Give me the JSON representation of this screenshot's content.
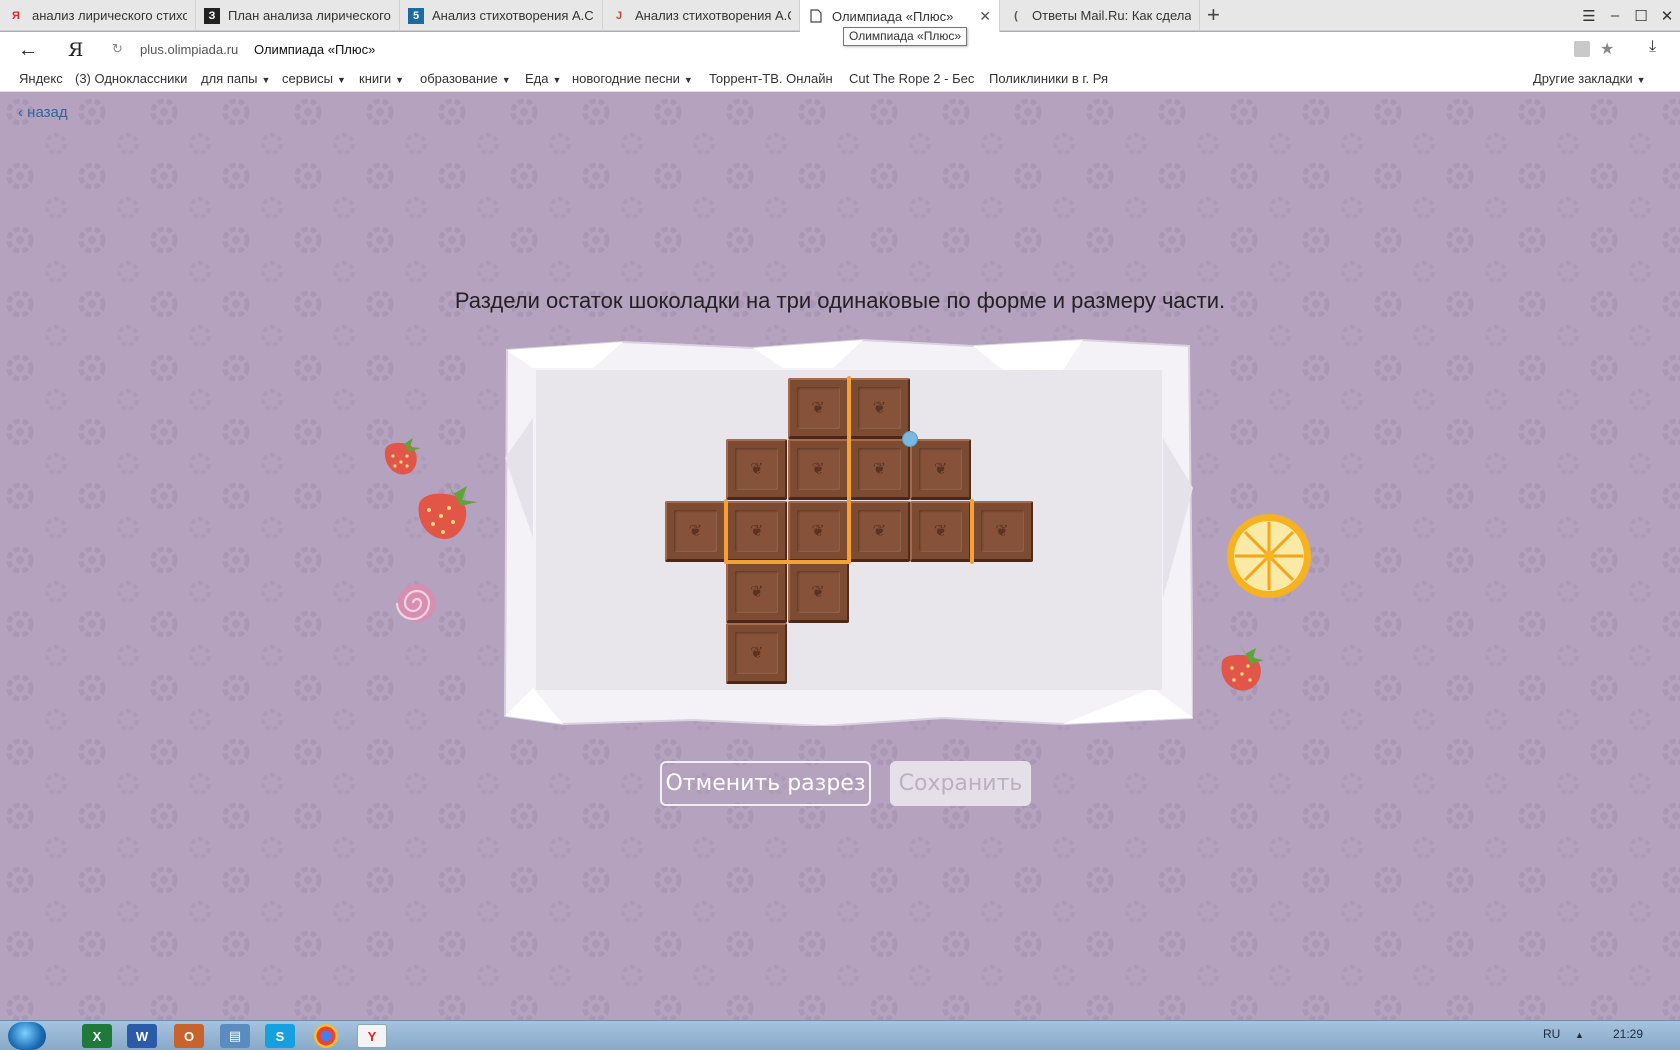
{
  "browser": {
    "tabs": [
      {
        "title": "анализ лирического стихот",
        "favicon": "Я"
      },
      {
        "title": "План анализа лирического",
        "favicon": "З"
      },
      {
        "title": "Анализ стихотворения А.С.",
        "favicon": "5"
      },
      {
        "title": "Анализ стихотворения А.С.",
        "favicon": "Ј"
      },
      {
        "title": "Олимпиада «Плюс»",
        "favicon": "page"
      },
      {
        "title": "Ответы Mail.Ru: Как сделать",
        "favicon": "("
      }
    ],
    "active_tab_index": 4,
    "tab_close": "✕",
    "new_tab": "+",
    "tooltip": "Олимпиада «Плюс»",
    "address": {
      "back": "←",
      "logo": "Я",
      "reload": "↻",
      "url": "plus.olimpiada.ru",
      "title": "Олимпиада «Плюс»",
      "star": "★",
      "download": "⤓"
    },
    "window_controls": [
      "☰",
      "–",
      "☐",
      "✕"
    ],
    "bookmarks": [
      {
        "label": "Яндекс",
        "dropdown": false
      },
      {
        "label": "(3) Одноклассники",
        "dropdown": false
      },
      {
        "label": "для папы",
        "dropdown": true
      },
      {
        "label": "сервисы",
        "dropdown": true
      },
      {
        "label": "книги",
        "dropdown": true
      },
      {
        "label": "образование",
        "dropdown": true
      },
      {
        "label": "Еда",
        "dropdown": true
      },
      {
        "label": "новогодние песни",
        "dropdown": true
      },
      {
        "label": "Торрент-ТВ. Онлайн",
        "dropdown": false
      },
      {
        "label": "Cut The Rope 2 - Бес",
        "dropdown": false
      },
      {
        "label": "Поликлиники в г. Ря",
        "dropdown": false
      }
    ],
    "bookmarks_other": "Другие закладки",
    "caret": "▼"
  },
  "page": {
    "back_link": "назад",
    "task_text": "Раздели остаток шоколадки на три одинаковые по форме и размеру части.",
    "buttons": {
      "cancel_cut": "Отменить разрез",
      "save": "Сохранить"
    },
    "colors": {
      "background": "#b4a2bf",
      "chocolate": "#7d4a32",
      "cut_line": "#f5a135",
      "cut_point": "#7ab8dd"
    },
    "chocolate_grid": {
      "rows": 5,
      "cols": 6,
      "filled_cells": [
        [
          0,
          2
        ],
        [
          0,
          3
        ],
        [
          1,
          1
        ],
        [
          1,
          2
        ],
        [
          1,
          3
        ],
        [
          1,
          4
        ],
        [
          2,
          0
        ],
        [
          2,
          1
        ],
        [
          2,
          2
        ],
        [
          2,
          3
        ],
        [
          2,
          4
        ],
        [
          2,
          5
        ],
        [
          3,
          1
        ],
        [
          3,
          2
        ],
        [
          4,
          1
        ]
      ]
    },
    "cuts": [
      {
        "orientation": "vertical",
        "col_line": 3,
        "from_row": 0,
        "to_row": 3
      },
      {
        "orientation": "horizontal",
        "row_line": 3,
        "from_col": 1,
        "to_col": 3
      },
      {
        "orientation": "vertical",
        "col_line": 1,
        "from_row": 2,
        "to_row": 3
      },
      {
        "orientation": "vertical",
        "col_line": 5,
        "from_row": 2,
        "to_row": 3
      }
    ],
    "active_point": {
      "row_line": 1,
      "col_line": 4
    },
    "decorations": [
      "strawberry-icon",
      "strawberry-icon",
      "candy-icon",
      "orange-slice-icon",
      "strawberry-icon"
    ]
  },
  "taskbar": {
    "apps": [
      "excel-icon",
      "word-icon",
      "outlook-icon",
      "notepad-icon",
      "skype-icon",
      "chrome-icon",
      "yandex-browser-icon"
    ],
    "lang": "RU",
    "tray_arrow": "▲",
    "time": "21:29"
  }
}
